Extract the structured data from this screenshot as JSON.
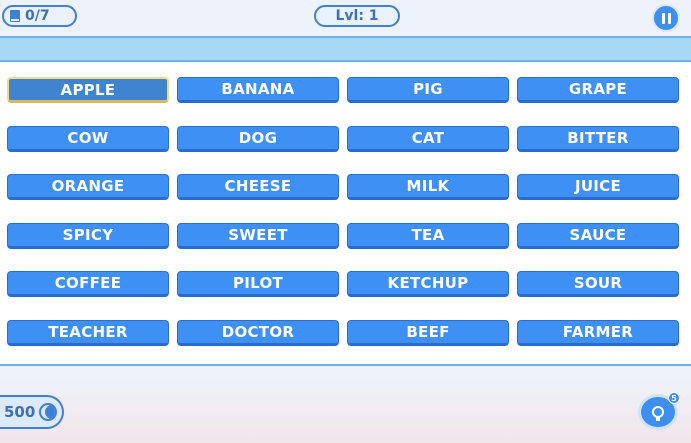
{
  "header": {
    "progress": "0/7",
    "level": "Lvl: 1"
  },
  "icons": {
    "progress": "book-icon",
    "pause": "pause-icon",
    "coins": "moon-coin-icon",
    "hint": "lightbulb-icon"
  },
  "colors": {
    "tile": "#3f90f5",
    "tile_selected": "#3f84cf",
    "accent": "#3f7fd4",
    "strip": "#a6d9f5"
  },
  "board": {
    "tiles": [
      {
        "word": "APPLE",
        "selected": true
      },
      {
        "word": "BANANA"
      },
      {
        "word": "PIG"
      },
      {
        "word": "GRAPE"
      },
      {
        "word": "COW"
      },
      {
        "word": "DOG"
      },
      {
        "word": "CAT"
      },
      {
        "word": "BITTER"
      },
      {
        "word": "ORANGE"
      },
      {
        "word": "CHEESE"
      },
      {
        "word": "MILK"
      },
      {
        "word": "JUICE"
      },
      {
        "word": "SPICY"
      },
      {
        "word": "SWEET"
      },
      {
        "word": "TEA"
      },
      {
        "word": "SAUCE"
      },
      {
        "word": "COFFEE"
      },
      {
        "word": "PILOT"
      },
      {
        "word": "KETCHUP"
      },
      {
        "word": "SOUR"
      },
      {
        "word": "TEACHER"
      },
      {
        "word": "DOCTOR"
      },
      {
        "word": "BEEF"
      },
      {
        "word": "FARMER"
      }
    ]
  },
  "footer": {
    "coins": "500",
    "hint_count": "5"
  }
}
